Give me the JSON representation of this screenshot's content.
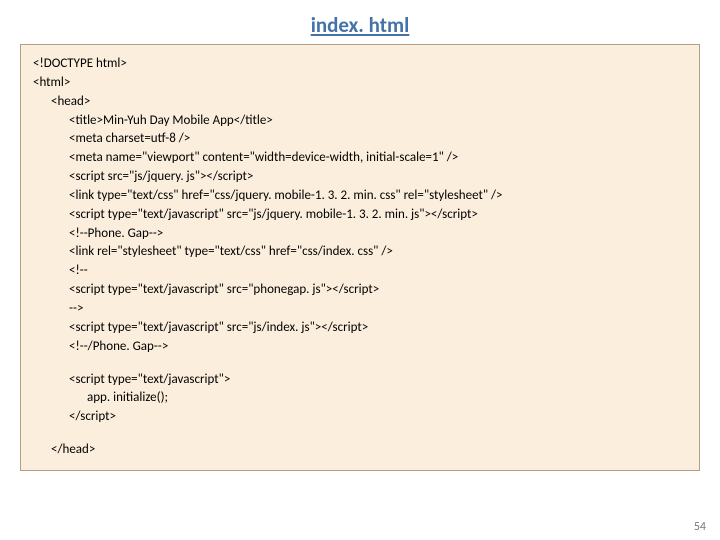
{
  "title": "index. html",
  "code": {
    "l1": "<!DOCTYPE html>",
    "l2": "<html>",
    "l3": "<head>",
    "l4": "<title>Min-Yuh Day Mobile App</title>",
    "l5": "<meta charset=utf-8 />",
    "l6": "<meta name=\"viewport\" content=\"width=device-width, initial-scale=1\" />",
    "l7": "<script src=\"js/jquery. js\"></script>",
    "l8": "<link type=\"text/css\" href=\"css/jquery. mobile-1. 3. 2. min. css\" rel=\"stylesheet\" />",
    "l9": "<script type=\"text/javascript\" src=\"js/jquery. mobile-1. 3. 2. min. js\"></script>",
    "l10": "<!--Phone. Gap-->",
    "l11": "<link rel=\"stylesheet\" type=\"text/css\" href=\"css/index. css\" />",
    "l12": "<!--",
    "l13": "<script type=\"text/javascript\" src=\"phonegap. js\"></script>",
    "l14": "-->",
    "l15": "<script type=\"text/javascript\" src=\"js/index. js\"></script>",
    "l16": "<!--/Phone. Gap-->",
    "l17": "<script type=\"text/javascript\">",
    "l18": "app. initialize();",
    "l19": "</script>",
    "l20": "</head>"
  },
  "pagenum": "54"
}
